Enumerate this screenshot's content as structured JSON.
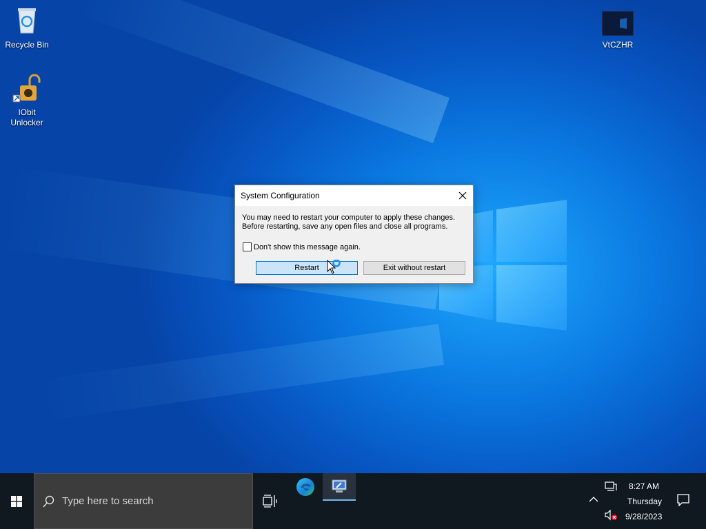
{
  "desktop": {
    "icons": [
      {
        "name": "recycle-bin",
        "label": "Recycle Bin"
      },
      {
        "name": "iobit-unlocker",
        "label": "IObit\nUnlocker"
      },
      {
        "name": "vtczhr",
        "label": "VtCZHR"
      }
    ]
  },
  "dialog": {
    "title": "System Configuration",
    "message_line1": "You may need to restart your computer to apply these changes.",
    "message_line2": "Before restarting, save any open files and close all programs.",
    "checkbox_label": "Don't show this message again.",
    "checkbox_checked": false,
    "restart_label": "Restart",
    "exit_label": "Exit without restart"
  },
  "taskbar": {
    "search_placeholder": "Type here to search",
    "clock_time": "8:27 AM",
    "clock_day": "Thursday",
    "clock_date": "9/28/2023",
    "accent": "#76b9ed",
    "pinned": [
      "edge-icon",
      "system-configuration-icon"
    ]
  },
  "colors": {
    "desktop_blue": "#0a78e0",
    "button_focus": "#0078d7",
    "taskbar_bg": "#101820"
  }
}
